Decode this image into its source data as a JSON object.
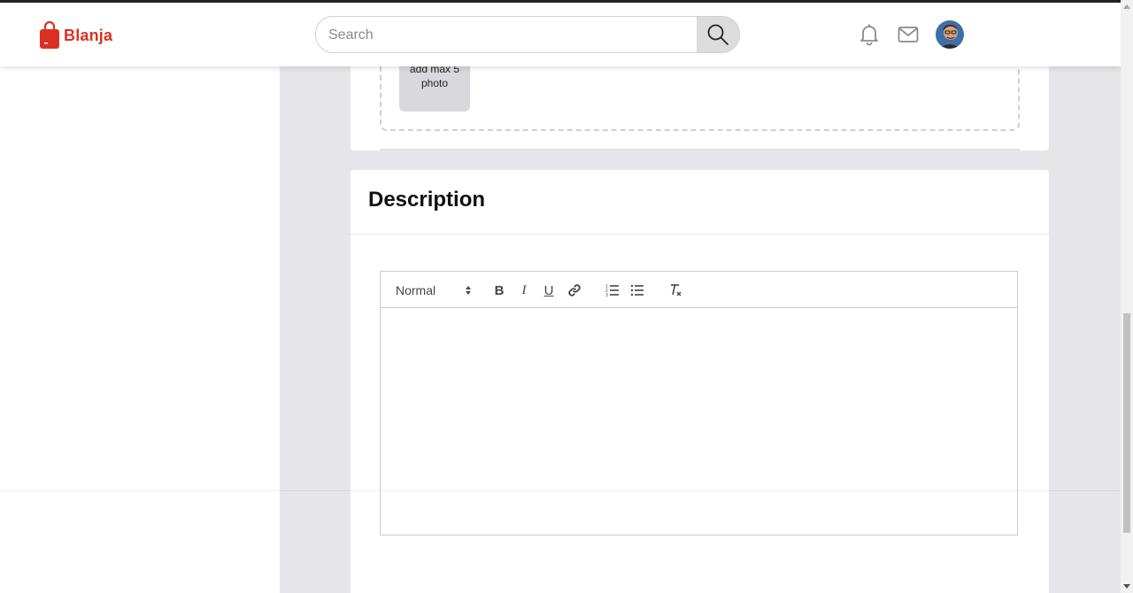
{
  "header": {
    "brand": "Blanja",
    "search_placeholder": "Search",
    "brand_color": "#db3022"
  },
  "upload": {
    "photo_hint": "add max 5 photo"
  },
  "description": {
    "title": "Description",
    "toolbar": {
      "format_value": "Normal",
      "bold_label": "B",
      "italic_label": "I",
      "underline_label": "U"
    },
    "body_text": ""
  },
  "icons": {
    "logo": "shopping-bag-icon",
    "search": "search-icon",
    "notifications": "bell-icon",
    "messages": "mail-icon",
    "link": "link-icon",
    "ordered_list": "ordered-list-icon",
    "bullet_list": "bullet-list-icon",
    "clear_format": "clear-format-icon"
  }
}
